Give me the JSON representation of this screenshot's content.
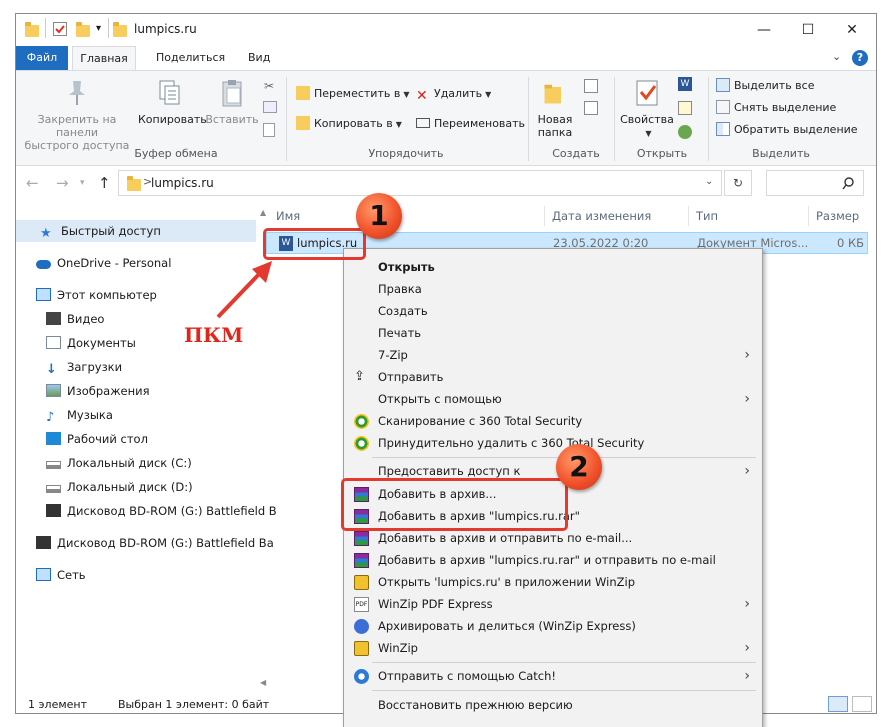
{
  "window": {
    "title": "lumpics.ru",
    "minimize": "—",
    "maximize": "☐",
    "close": "✕"
  },
  "ribbon_tabs": {
    "file": "Файл",
    "home": "Главная",
    "share": "Поделиться",
    "view": "Вид"
  },
  "ribbon": {
    "clipboard": {
      "pin_label": "Закрепить на панели быстрого доступа",
      "pin_line1": "Закрепить на панели",
      "pin_line2": "быстрого доступа",
      "copy": "Копировать",
      "paste": "Вставить",
      "group": "Буфер обмена"
    },
    "organize": {
      "move_to": "Переместить в",
      "copy_to": "Копировать в",
      "delete": "Удалить",
      "rename": "Переименовать",
      "group": "Упорядочить"
    },
    "new": {
      "new_folder_line1": "Новая",
      "new_folder_line2": "папка",
      "group": "Создать"
    },
    "open": {
      "properties": "Свойства",
      "group": "Открыть"
    },
    "select": {
      "select_all": "Выделить все",
      "select_none": "Снять выделение",
      "invert": "Обратить выделение",
      "group": "Выделить"
    }
  },
  "address": {
    "path": "lumpics.ru",
    "separator": ">"
  },
  "nav": {
    "quick_access": "Быстрый доступ",
    "onedrive": "OneDrive - Personal",
    "this_pc": "Этот компьютер",
    "video": "Видео",
    "documents": "Документы",
    "downloads": "Загрузки",
    "pictures": "Изображения",
    "music": "Музыка",
    "desktop": "Рабочий стол",
    "disk_c": "Локальный диск (C:)",
    "disk_d": "Локальный диск (D:)",
    "bd_rom_1": "Дисковод BD-ROM (G:) Battlefield B",
    "bd_rom_2": "Дисковод BD-ROM (G:) Battlefield Ba",
    "network": "Сеть"
  },
  "columns": {
    "name": "Имя",
    "date": "Дата изменения",
    "type": "Тип",
    "size": "Размер"
  },
  "file": {
    "name": "lumpics.ru",
    "date": "23.05.2022 0:20",
    "type": "Документ Micros...",
    "size": "0 КБ"
  },
  "context_menu": {
    "open": "Открыть",
    "edit": "Правка",
    "new": "Создать",
    "print": "Печать",
    "sevenzip": "7-Zip",
    "send": "Отправить",
    "open_with": "Открыть с помощью",
    "scan_360": "Сканирование с 360 Total Security",
    "force_delete_360": "Принудительно удалить с  360 Total Security",
    "give_access": "Предоставить доступ к",
    "add_to_archive": "Добавить в архив...",
    "add_to_rar": "Добавить в архив \"lumpics.ru.rar\"",
    "add_and_email": "Добавить в архив и отправить по e-mail...",
    "add_rar_and_email": "Добавить в архив \"lumpics.ru.rar\" и отправить по e-mail",
    "open_in_winzip": "Открыть 'lumpics.ru' в приложении WinZip",
    "winzip_pdf": "WinZip PDF Express",
    "archive_share": "Архивировать и делиться (WinZip Express)",
    "winzip": "WinZip",
    "send_catch": "Отправить с помощью Catch!",
    "restore_prev": "Восстановить прежнюю версию"
  },
  "status": {
    "count": "1 элемент",
    "selected": "Выбран 1 элемент: 0 байт"
  },
  "annotations": {
    "step1": "1",
    "step2": "2",
    "rmb": "ПКМ"
  },
  "colors": {
    "accent": "#1e6dc0",
    "selection": "#cce8ff",
    "annotation_red": "#e23a2e"
  }
}
